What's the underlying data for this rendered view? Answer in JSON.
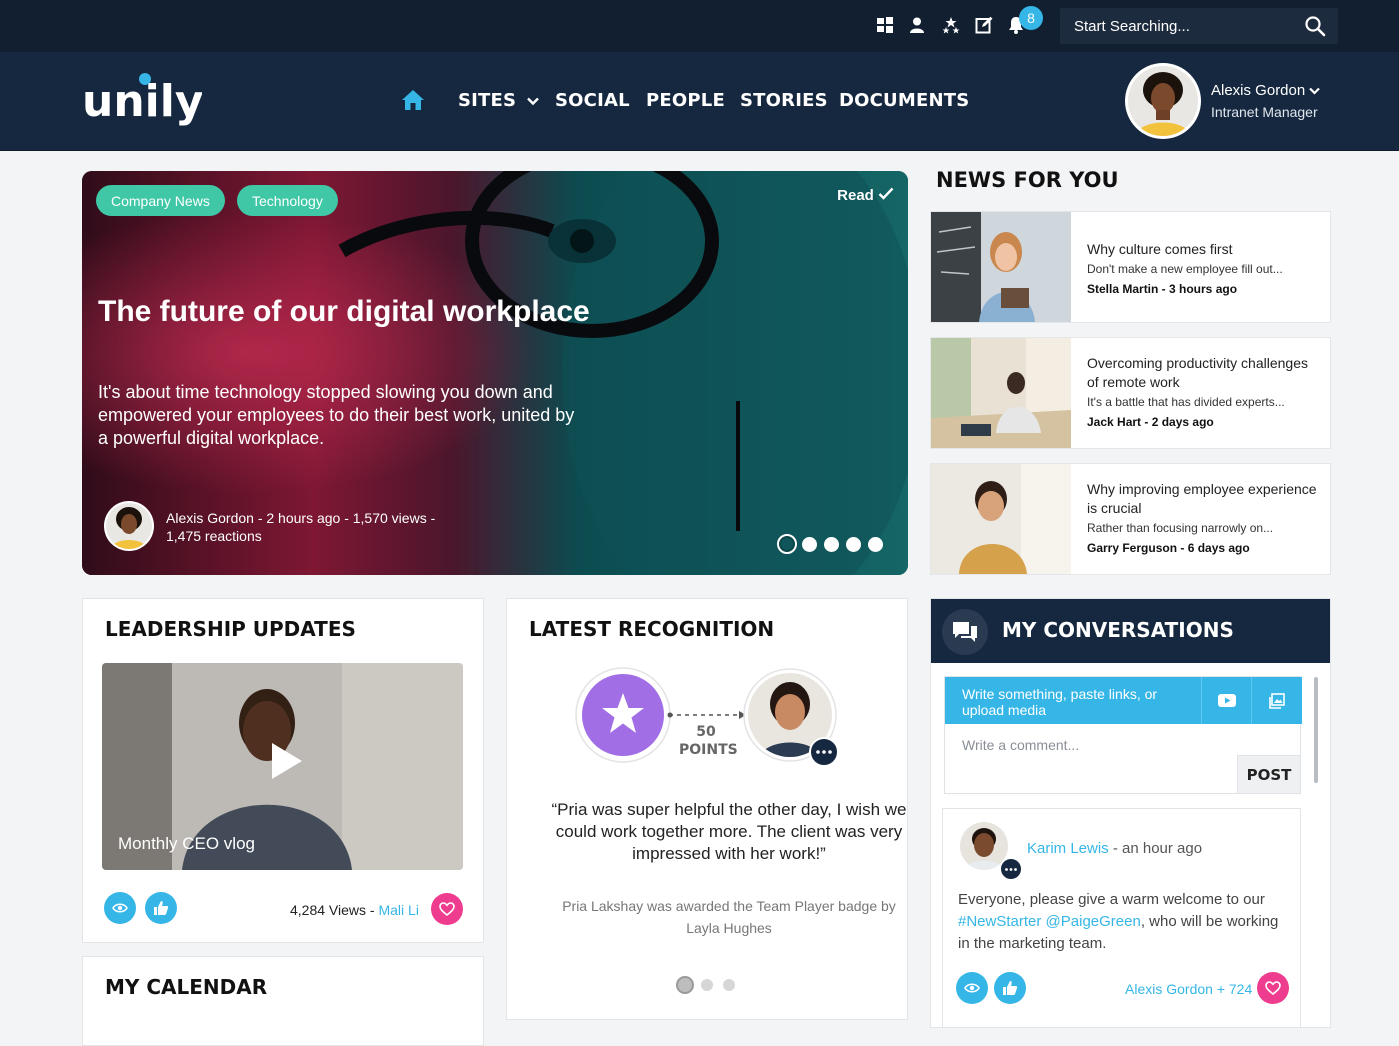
{
  "topbar": {
    "icons": [
      "windows-icon",
      "user-icon",
      "stars-icon",
      "edit-icon",
      "bell-icon"
    ],
    "notification_count": "8",
    "search_placeholder": "Start Searching..."
  },
  "nav": {
    "brand": "unily",
    "items": [
      "SITES",
      "SOCIAL",
      "PEOPLE",
      "STORIES",
      "DOCUMENTS"
    ],
    "user_name": "Alexis Gordon",
    "user_role": "Intranet Manager"
  },
  "hero": {
    "tags": [
      "Company News",
      "Technology"
    ],
    "read_label": "Read",
    "title": "The future of our digital workplace",
    "description": "It's about time technology stopped slowing you down and empowered your employees to do their best work, united by a powerful digital workplace.",
    "meta_line1": "Alexis Gordon - 2 hours ago  - 1,570 views -",
    "meta_line2": "1,475 reactions",
    "slide_count": 5,
    "active_slide": 1
  },
  "news_for_you": {
    "title": "NEWS FOR YOU",
    "items": [
      {
        "title": "Why culture comes first",
        "excerpt": "Don't make a new employee fill out...",
        "meta": "Stella Martin - 3 hours ago"
      },
      {
        "title": "Overcoming productivity challenges of remote work",
        "excerpt": "It's a battle that has divided experts...",
        "meta": "Jack Hart - 2 days ago"
      },
      {
        "title": "Why improving employee experience is crucial",
        "excerpt": "Rather than focusing narrowly on...",
        "meta": "Garry Ferguson - 6 days ago"
      }
    ]
  },
  "leadership": {
    "title": "LEADERSHIP UPDATES",
    "video_label": "Monthly CEO vlog",
    "views": "4,284 Views",
    "separator": " - ",
    "author": "Mali Li"
  },
  "recognition": {
    "title": "LATEST RECOGNITION",
    "points_value": "50",
    "points_label": "POINTS",
    "quote": "“Pria was super helpful the other day, I wish we could work together more. The client was very impressed with her work!”",
    "award": "Pria Lakshay was awarded the Team Player badge by Layla Hughes",
    "slide_count": 3,
    "active_slide": 1
  },
  "calendar": {
    "title": "MY CALENDAR"
  },
  "conversations": {
    "title": "MY CONVERSATIONS",
    "composer_prompt": "Write something, paste links, or upload media",
    "comment_placeholder": "Write a comment...",
    "post_label": "POST",
    "post": {
      "author": "Karim Lewis",
      "time": " - an hour ago",
      "body_start": "Everyone, please give a warm welcome to our ",
      "hashtag": "#NewStarter",
      "mention": "@PaigeGreen",
      "body_end": ", who will be working in the marketing team.",
      "reactors": "Alexis Gordon + 724"
    }
  },
  "colors": {
    "accent": "#35b6e6",
    "navy": "#16283f",
    "topbar": "#121f30",
    "tag_green": "#3fc7a6",
    "heart_pink": "#ee3c8e",
    "recognition_purple": "#a16ee6"
  }
}
